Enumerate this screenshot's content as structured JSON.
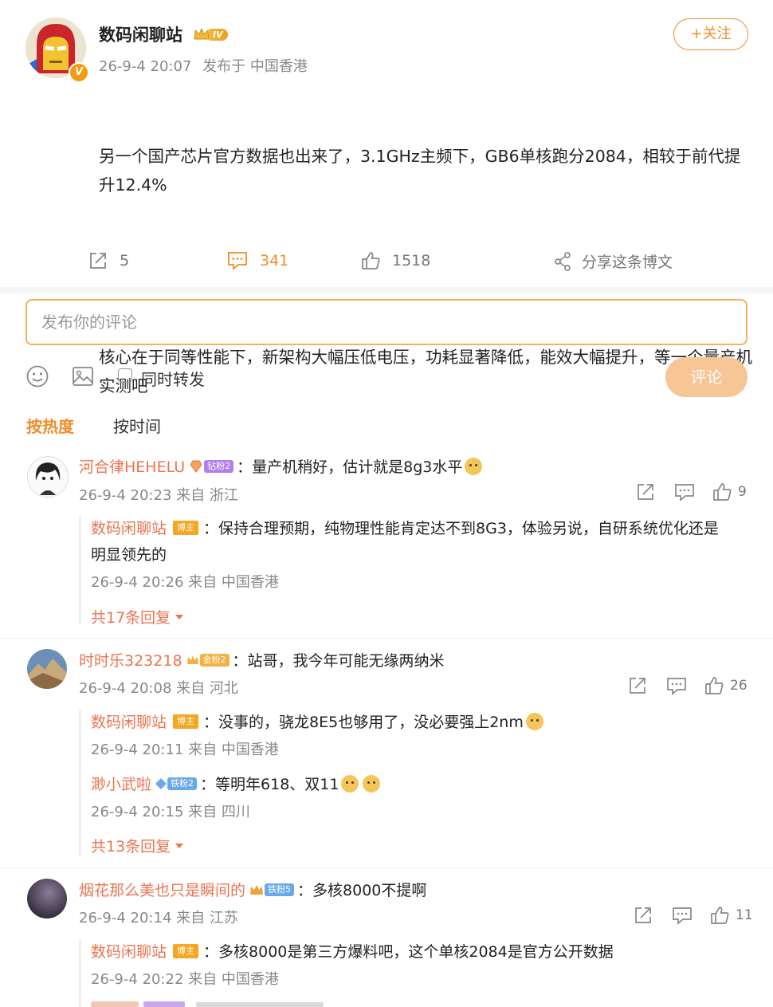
{
  "post": {
    "author": "数码闲聊站",
    "level": "IV",
    "verified_mark": "V",
    "time": "26-9-4 20:07",
    "location": "发布于 中国香港",
    "follow_label": "+关注",
    "paragraph1": "另一个国产芯片官方数据也出来了，3.1GHz主频下，GB6单核跑分2084，相较于前代提升12.4%",
    "paragraph2": "核心在于同等性能下，新架构大幅压低电压，功耗显著降低，能效大幅提升，等一个量产机实测吧"
  },
  "actions": {
    "repost_count": "5",
    "comment_count": "341",
    "like_count": "1518",
    "share_label": "分享这条博文"
  },
  "composer": {
    "placeholder": "发布你的评论",
    "repost_label": "同时转发",
    "submit_label": "评论"
  },
  "sort": {
    "hot": "按热度",
    "time": "按时间"
  },
  "comments": [
    {
      "user": "河合律HEHELU",
      "badge": "钻粉2",
      "text": "：量产机稍好，估计就是8g3水平",
      "time": "26-9-4 20:23 来自 浙江",
      "likes": "9",
      "replies": [
        {
          "user": "数码闲聊站",
          "tag": "博主",
          "text": "：保持合理预期，纯物理性能肯定达不到8G3，体验另说，自研系统优化还是",
          "text2": "明显领先的",
          "time": "26-9-4 20:26 来自 中国香港"
        }
      ],
      "more": "共17条回复"
    },
    {
      "user": "时时乐323218",
      "badge": "金粉2",
      "text": "：站哥，我今年可能无缘两纳米",
      "time": "26-9-4 20:08 来自 河北",
      "likes": "26",
      "replies": [
        {
          "user": "数码闲聊站",
          "tag": "博主",
          "text": "：没事的，骁龙8E5也够用了，没必要强上2nm",
          "time": "26-9-4 20:11 来自 中国香港"
        },
        {
          "user": "渺小武啦",
          "badge": "铁粉2",
          "text": "：等明年618、双11",
          "time": "26-9-4 20:15 来自 四川"
        }
      ],
      "more": "共13条回复"
    },
    {
      "user": "烟花那么美也只是瞬间的",
      "badge": "铁粉5",
      "text": "：多核8000不提啊",
      "time": "26-9-4 20:14 来自 江苏",
      "likes": "11",
      "replies": [
        {
          "user": "数码闲聊站",
          "tag": "博主",
          "text": "：多核8000是第三方爆料吧，这个单核2084是官方公开数据",
          "time": "26-9-4 20:22 来自 中国香港"
        }
      ]
    }
  ],
  "colors": {
    "accent": "#f08d2a",
    "username": "#eb7350",
    "submit_disabled": "#f8c595",
    "diamond_fan": "#b37feb",
    "gold_fan": "#f5b041",
    "iron_fan": "#6aa9e9",
    "blogger_tag": "#f5a623"
  }
}
